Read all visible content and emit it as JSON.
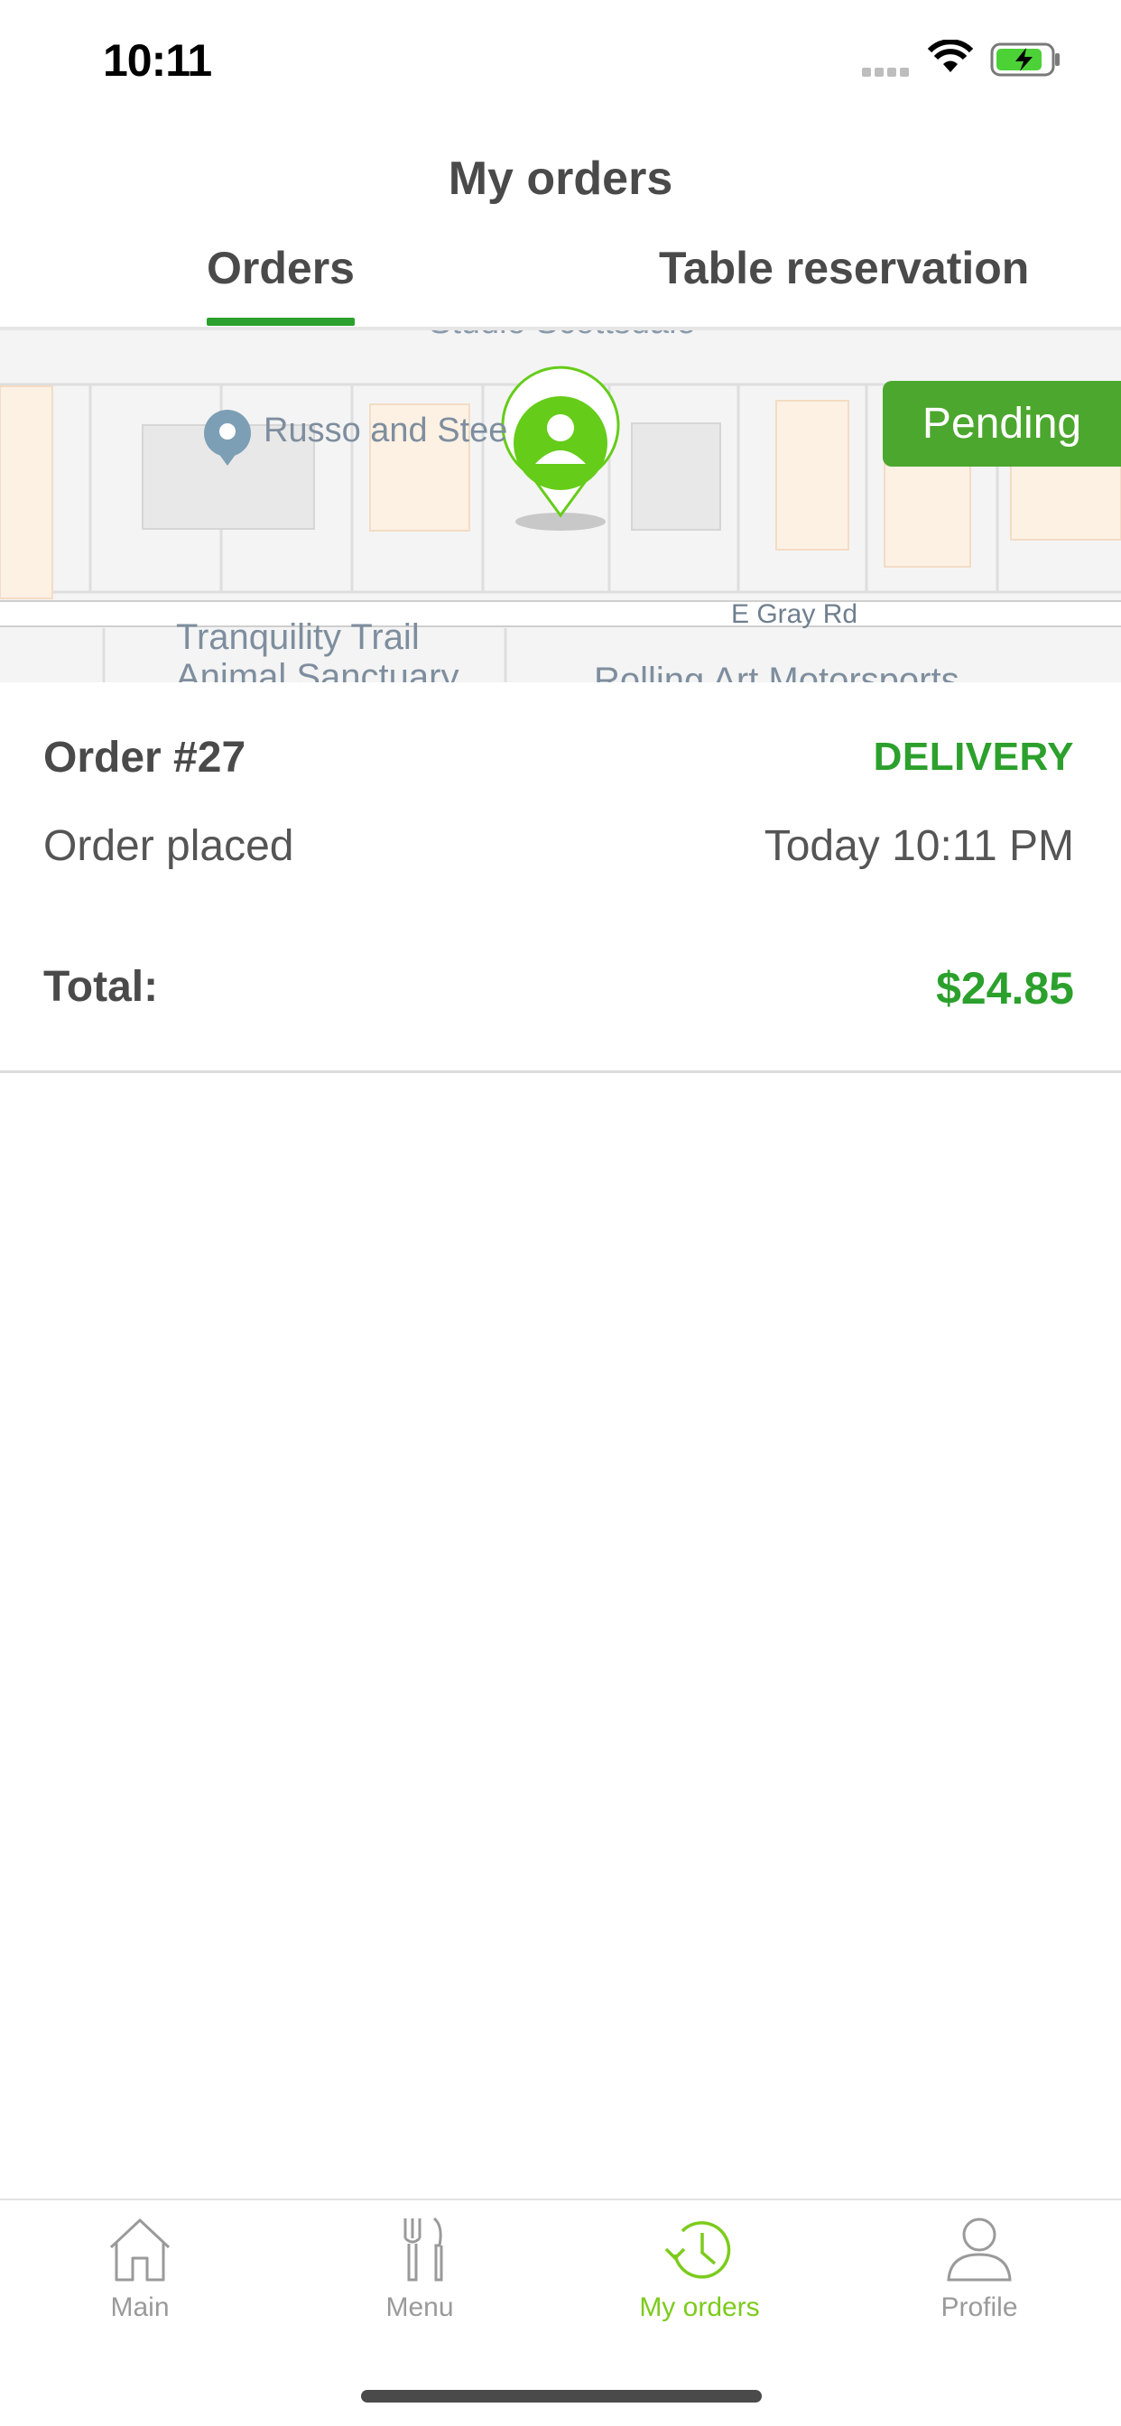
{
  "status_bar": {
    "time": "10:11"
  },
  "header": {
    "title": "My orders"
  },
  "tabs": [
    {
      "label": "Orders",
      "active": true
    },
    {
      "label": "Table reservation",
      "active": false
    }
  ],
  "map": {
    "labels": {
      "top_cut": "Studio Scottsdale",
      "place": "Russo and Steele",
      "road": "E Gray Rd",
      "poi_1": "Tranquility Trail",
      "poi_2": "Animal Sanctuary",
      "poi_3": "Rolling Art Motorsports"
    },
    "marker_icon": "user-location-pin-icon"
  },
  "order": {
    "status_badge": "Pending",
    "number": "Order #27",
    "type": "DELIVERY",
    "placed_label": "Order placed",
    "placed_value": "Today 10:11 PM",
    "total_label": "Total:",
    "total_value": "$24.85"
  },
  "bottom_nav": [
    {
      "label": "Main",
      "icon": "home-icon",
      "active": false
    },
    {
      "label": "Menu",
      "icon": "cutlery-icon",
      "active": false
    },
    {
      "label": "My orders",
      "icon": "history-clock-icon",
      "active": true
    },
    {
      "label": "Profile",
      "icon": "person-icon",
      "active": false
    }
  ],
  "colors": {
    "accent_green": "#2ca02c",
    "badge_green": "#4ca72e",
    "nav_active": "#7ccb1c",
    "nav_inactive": "#9a9a9a"
  }
}
